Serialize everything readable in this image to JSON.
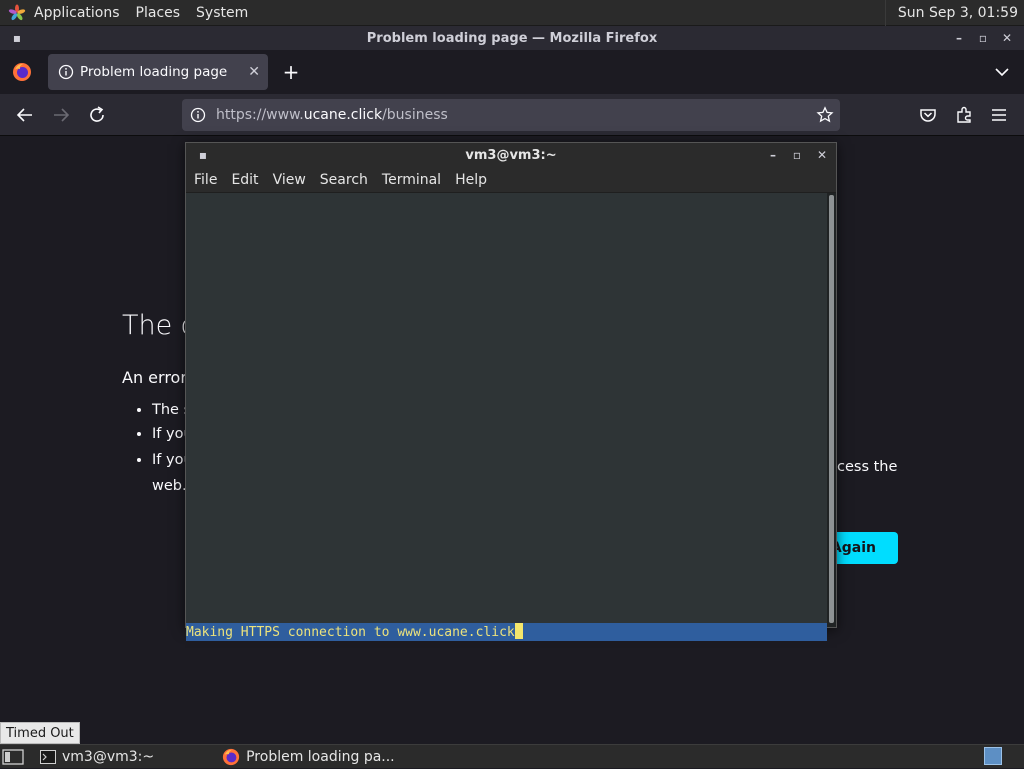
{
  "top_panel": {
    "applications": "Applications",
    "places": "Places",
    "system": "System",
    "clock": "Sun Sep  3, 01:59"
  },
  "firefox": {
    "window_title": "Problem loading page — Mozilla Firefox",
    "tab_title": "Problem loading page",
    "url_scheme": "https://www.",
    "url_host": "ucane.click",
    "url_path": "/business"
  },
  "error_page": {
    "title_fragment": "The c",
    "subtitle_fragment": "An error",
    "bullets": [
      "The s",
      "If you",
      "If you"
    ],
    "right_text": "cess the",
    "web_text": "web.",
    "button_fragment": "Again",
    "status_tooltip": "Timed Out"
  },
  "terminal": {
    "title": "vm3@vm3:~",
    "menu": [
      "File",
      "Edit",
      "View",
      "Search",
      "Terminal",
      "Help"
    ],
    "output_line": "Making HTTPS connection to www.ucane.click"
  },
  "taskbar": {
    "items": [
      {
        "label": "vm3@vm3:~"
      },
      {
        "label": "Problem loading pa..."
      }
    ]
  },
  "colors": {
    "accent": "#00ddff",
    "terminal_highlight": "#2f5e9e",
    "terminal_text": "#ece27c"
  }
}
